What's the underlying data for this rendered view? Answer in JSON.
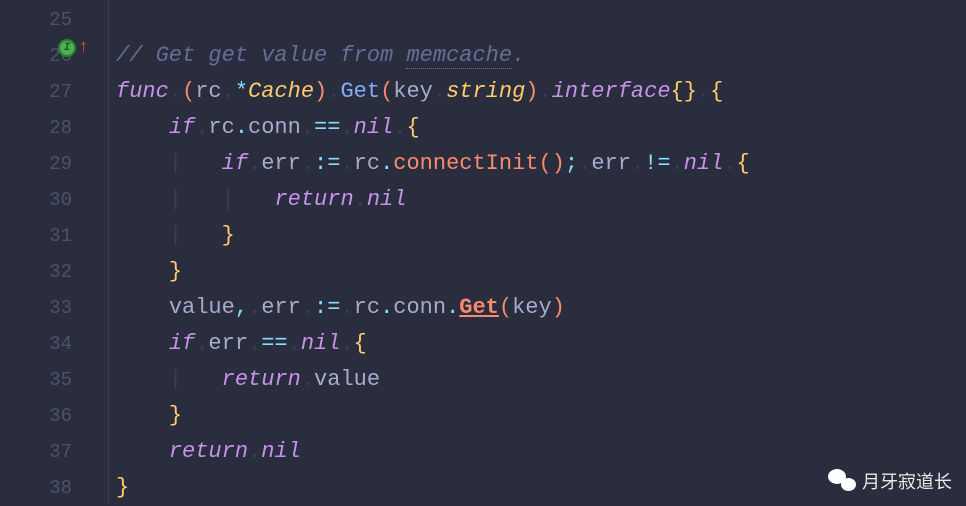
{
  "gutter": {
    "lines": [
      "25",
      "26",
      "27",
      "28",
      "29",
      "30",
      "31",
      "32",
      "33",
      "34",
      "35",
      "36",
      "37",
      "38"
    ]
  },
  "code": {
    "l25": "",
    "l26_comment": "// Get get value from ",
    "l26_mem": "memcache",
    "l26_dot": ".",
    "l27_func": "func",
    "l27_rc": "rc",
    "l27_star": "*",
    "l27_cache": "Cache",
    "l27_get": "Get",
    "l27_key": "key",
    "l27_string": "string",
    "l27_interface": "interface",
    "l28_if": "if",
    "l28_rc": "rc",
    "l28_conn": "conn",
    "l28_eq": "==",
    "l28_nil": "nil",
    "l29_if": "if",
    "l29_err": "err",
    "l29_assign": ":=",
    "l29_rc": "rc",
    "l29_connectInit": "connectInit",
    "l29_err2": "err",
    "l29_neq": "!=",
    "l29_nil": "nil",
    "l30_return": "return",
    "l30_nil": "nil",
    "l33_value": "value",
    "l33_err": "err",
    "l33_assign": ":=",
    "l33_rc": "rc",
    "l33_conn": "conn",
    "l33_get": "Get",
    "l33_key": "key",
    "l34_if": "if",
    "l34_err": "err",
    "l34_eq": "==",
    "l34_nil": "nil",
    "l35_return": "return",
    "l35_value": "value",
    "l37_return": "return",
    "l37_nil": "nil"
  },
  "ws": ".",
  "guide": "|",
  "brace_open": "{",
  "brace_close": "}",
  "paren_open": "(",
  "paren_close": ")",
  "semicolon": ";",
  "comma": ",",
  "dot": ".",
  "watermark": "月牙寂道长"
}
